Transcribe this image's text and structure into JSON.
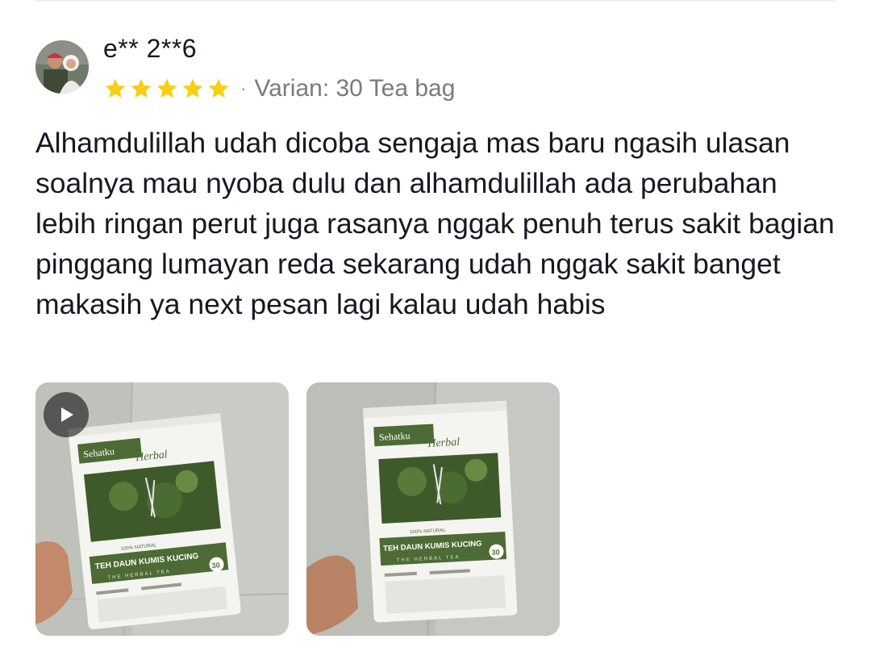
{
  "review": {
    "username": "e** 2**6",
    "rating": 5,
    "rating_max": 5,
    "separator": "·",
    "variant": "Varian: 30 Tea bag",
    "text": "Alhamdulillah udah dicoba sengaja mas baru ngasih ulasan soalnya mau nyoba dulu dan alhamdulillah ada perubahan lebih ringan perut juga rasanya nggak penuh terus sakit bagian pinggang lumayan reda sekarang udah nggak sakit banget makasih ya next pesan lagi kalau udah habis"
  },
  "media": [
    {
      "type": "video",
      "icon": "play-icon"
    },
    {
      "type": "image"
    }
  ],
  "product_label": {
    "brand": "Sehatku",
    "brand_script": "Herbal",
    "name": "TEH DAUN KUMIS KUCING",
    "tagline": "THE HERBAL TEA",
    "natural": "100% NATURAL",
    "count": "30"
  },
  "colors": {
    "star": "#FACE15",
    "text": "#161823",
    "muted": "#7a7b80",
    "pack_green": "#4d6b35"
  }
}
